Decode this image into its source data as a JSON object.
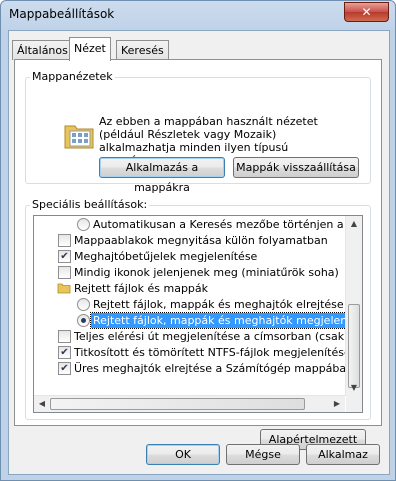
{
  "window": {
    "title": "Mappabeállítások",
    "close_label": "✕"
  },
  "tabs": [
    {
      "label": "Általános"
    },
    {
      "label": "Nézet"
    },
    {
      "label": "Keresés"
    }
  ],
  "folder_views": {
    "group_label": "Mappanézetek",
    "description": "Az ebben a mappában használt nézetet (például Részletek vagy Mozaik) alkalmazhatja minden ilyen típusú mappára.",
    "apply_button": "Alkalmazás a mappákra",
    "reset_button": "Mappák visszaállítása"
  },
  "advanced": {
    "group_label": "Speciális beállítások:",
    "items": [
      {
        "type": "radio",
        "checked": false,
        "indent": 2,
        "label": "Automatikusan a Keresés mezőbe történjen a beírás"
      },
      {
        "type": "checkbox",
        "checked": false,
        "indent": 1,
        "label": "Mappaablakok megnyitása külön folyamatban"
      },
      {
        "type": "checkbox",
        "checked": true,
        "indent": 1,
        "label": "Meghajtóbetűjelek megjelenítése"
      },
      {
        "type": "checkbox",
        "checked": false,
        "indent": 1,
        "label": "Mindig ikonok jelenjenek meg (miniatűrök soha)"
      },
      {
        "type": "folder",
        "indent": 1,
        "label": "Rejtett fájlok és mappák"
      },
      {
        "type": "radio",
        "checked": false,
        "indent": 2,
        "label": "Rejtett fájlok, mappák és meghajtók elrejtése"
      },
      {
        "type": "radio",
        "checked": true,
        "indent": 2,
        "selected": true,
        "label": "Rejtett fájlok, mappák és meghajtók megjelenítése"
      },
      {
        "type": "checkbox",
        "checked": false,
        "indent": 1,
        "label": "Teljes elérési út megjelenítése a címsorban (csak klasszikus téma esetén)"
      },
      {
        "type": "checkbox",
        "checked": true,
        "indent": 1,
        "label": "Titkosított és tömörített NTFS-fájlok megjelenítése színes"
      },
      {
        "type": "checkbox",
        "checked": true,
        "indent": 1,
        "label": "Üres meghajtók elrejtése a Számítógép mappában"
      }
    ],
    "restore_defaults_button": "Alapértelmezett"
  },
  "footer": {
    "ok": "OK",
    "cancel": "Mégse",
    "apply": "Alkalmaz"
  }
}
